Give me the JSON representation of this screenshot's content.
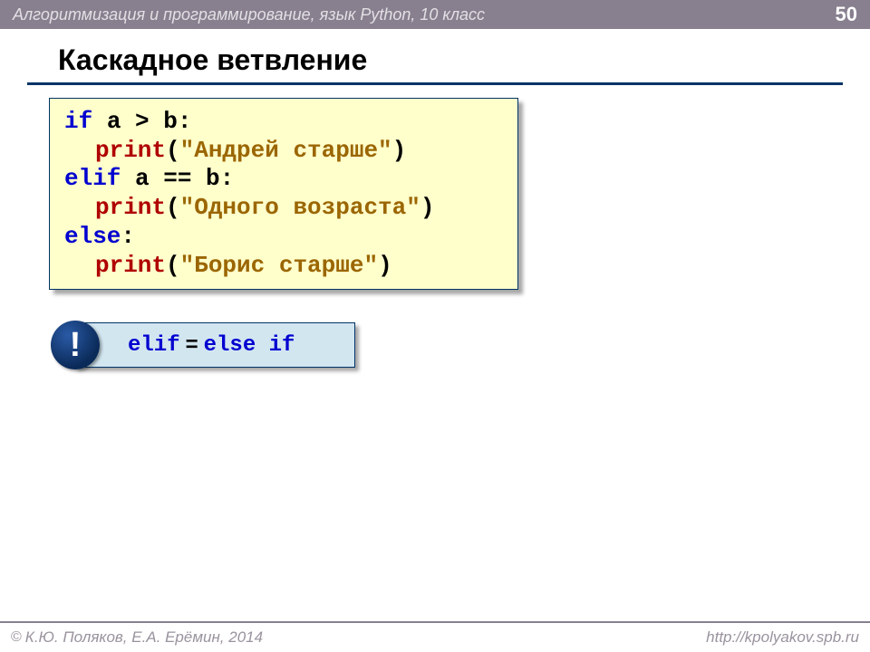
{
  "header": {
    "title": "Алгоритмизация и программирование, язык Python, 10 класс",
    "page_number": "50"
  },
  "slide": {
    "title": "Каскадное ветвление"
  },
  "code": {
    "line1_kw": "if",
    "line1_rest": " a > b:",
    "line2_fn": "print",
    "line2_paren_open": "(",
    "line2_str": "\"Андрей старше\"",
    "line2_paren_close": ")",
    "line3_kw": "elif",
    "line3_rest": " a == b:",
    "line4_fn": "print",
    "line4_paren_open": "(",
    "line4_str": "\"Одного возраста\"",
    "line4_paren_close": ")",
    "line5_kw": "else",
    "line5_rest": ":",
    "line6_fn": "print",
    "line6_paren_open": "(",
    "line6_str": "\"Борис старше\"",
    "line6_paren_close": ")"
  },
  "note": {
    "badge": "!",
    "part1": "elif",
    "eq": "=",
    "part2": "else if"
  },
  "footer": {
    "copyright_symbol": "©",
    "copyright_text": "К.Ю. Поляков, Е.А. Ерёмин, 2014",
    "url": "http://kpolyakov.spb.ru"
  }
}
